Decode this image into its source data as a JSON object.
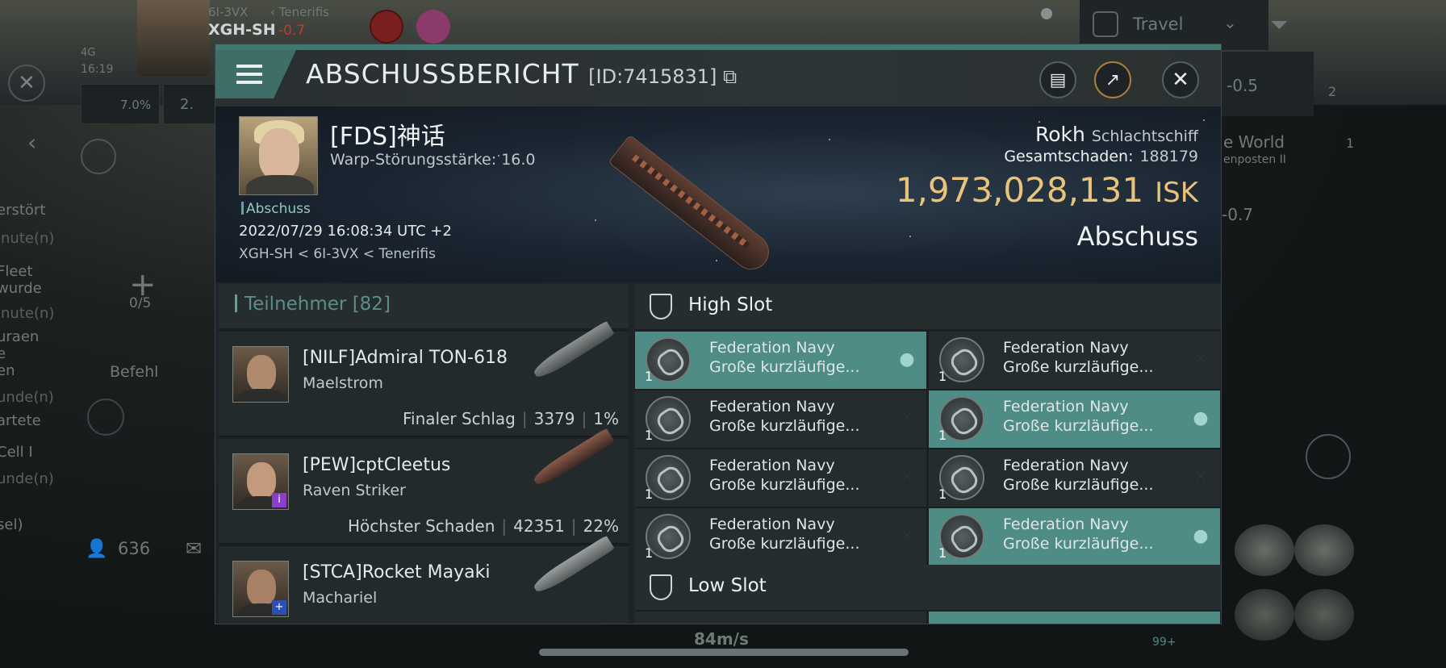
{
  "background": {
    "system": "6I-3VX",
    "region": "Tenerifis",
    "local": "XGH-SH",
    "sec": "-0.7",
    "clock": "16:19",
    "net": "4G",
    "travel_label": "Travel",
    "sec_right_1": "-0.5",
    "sec_right_2": "-0.7",
    "world_label": "e World",
    "outpost_label": "enposten II",
    "count_2": "2",
    "count_1": "1",
    "pct": "7.0%",
    "z_val": "2.",
    "slots": "0/5",
    "befehl": "Befehl",
    "users": "636",
    "speed": "84m/s",
    "badge_99": "99+",
    "left_clip": [
      "erstört",
      "inute(n)",
      "Fleet",
      "wurde",
      "inute(n)",
      "uraen",
      "e",
      "en",
      "unde(n)",
      "artete",
      "Cell I",
      "unde(n)",
      "sel)"
    ]
  },
  "modal": {
    "title": "ABSCHUSSBERICHT",
    "id": "[ID:7415831]",
    "victim": {
      "name": "[FDS]神话",
      "warp": "Warp-Störungsstärke: 16.0",
      "tag": "Abschuss",
      "date": "2022/07/29 16:08:34 UTC +2",
      "location": "XGH-SH < 6I-3VX < Tenerifis"
    },
    "ship": {
      "name": "Rokh",
      "class": "Schlachtschiff",
      "damage_label": "Gesamtschaden:",
      "damage": "188179",
      "isk": "1,973,028,131",
      "isk_unit": "ISK",
      "result": "Abschuss"
    },
    "participants": {
      "label": "Teilnehmer",
      "count": "[82]",
      "rows": [
        {
          "name": "[NILF]Admiral TON-618",
          "ship": "Maelstrom",
          "role": "Finaler Schlag",
          "damage": "3379",
          "pct": "1%"
        },
        {
          "name": "[PEW]cptCleetus",
          "ship": "Raven Striker",
          "role": "Höchster Schaden",
          "damage": "42351",
          "pct": "22%"
        },
        {
          "name": "[STCA]Rocket Mayaki",
          "ship": "Machariel",
          "role": "",
          "damage": "",
          "pct": ""
        }
      ]
    },
    "high_slot": {
      "label": "High Slot",
      "modules": [
        {
          "l1": "Federation Navy",
          "l2": "Große kurzläufige...",
          "qty": "1",
          "state": "pilot"
        },
        {
          "l1": "Federation Navy",
          "l2": "Große kurzläufige...",
          "qty": "1",
          "state": "x"
        },
        {
          "l1": "Federation Navy",
          "l2": "Große kurzläufige...",
          "qty": "1",
          "state": "x"
        },
        {
          "l1": "Federation Navy",
          "l2": "Große kurzläufige...",
          "qty": "1",
          "state": "pilot"
        },
        {
          "l1": "Federation Navy",
          "l2": "Große kurzläufige...",
          "qty": "1",
          "state": "x"
        },
        {
          "l1": "Federation Navy",
          "l2": "Große kurzläufige...",
          "qty": "1",
          "state": "x"
        },
        {
          "l1": "Federation Navy",
          "l2": "Große kurzläufige...",
          "qty": "1",
          "state": "x"
        },
        {
          "l1": "Federation Navy",
          "l2": "Große kurzläufige...",
          "qty": "1",
          "state": "pilot"
        }
      ]
    },
    "low_slot": {
      "label": "Low Slot"
    },
    "icons": {
      "menu": "hamburger-icon",
      "copy": "copy-icon",
      "clipboard": "clipboard-icon",
      "share": "share-icon",
      "close": "close-icon",
      "pilot": "pilot-icon",
      "x": "x-icon"
    },
    "colors": {
      "accent": "#4f8c85",
      "isk": "#e8c37c"
    }
  }
}
